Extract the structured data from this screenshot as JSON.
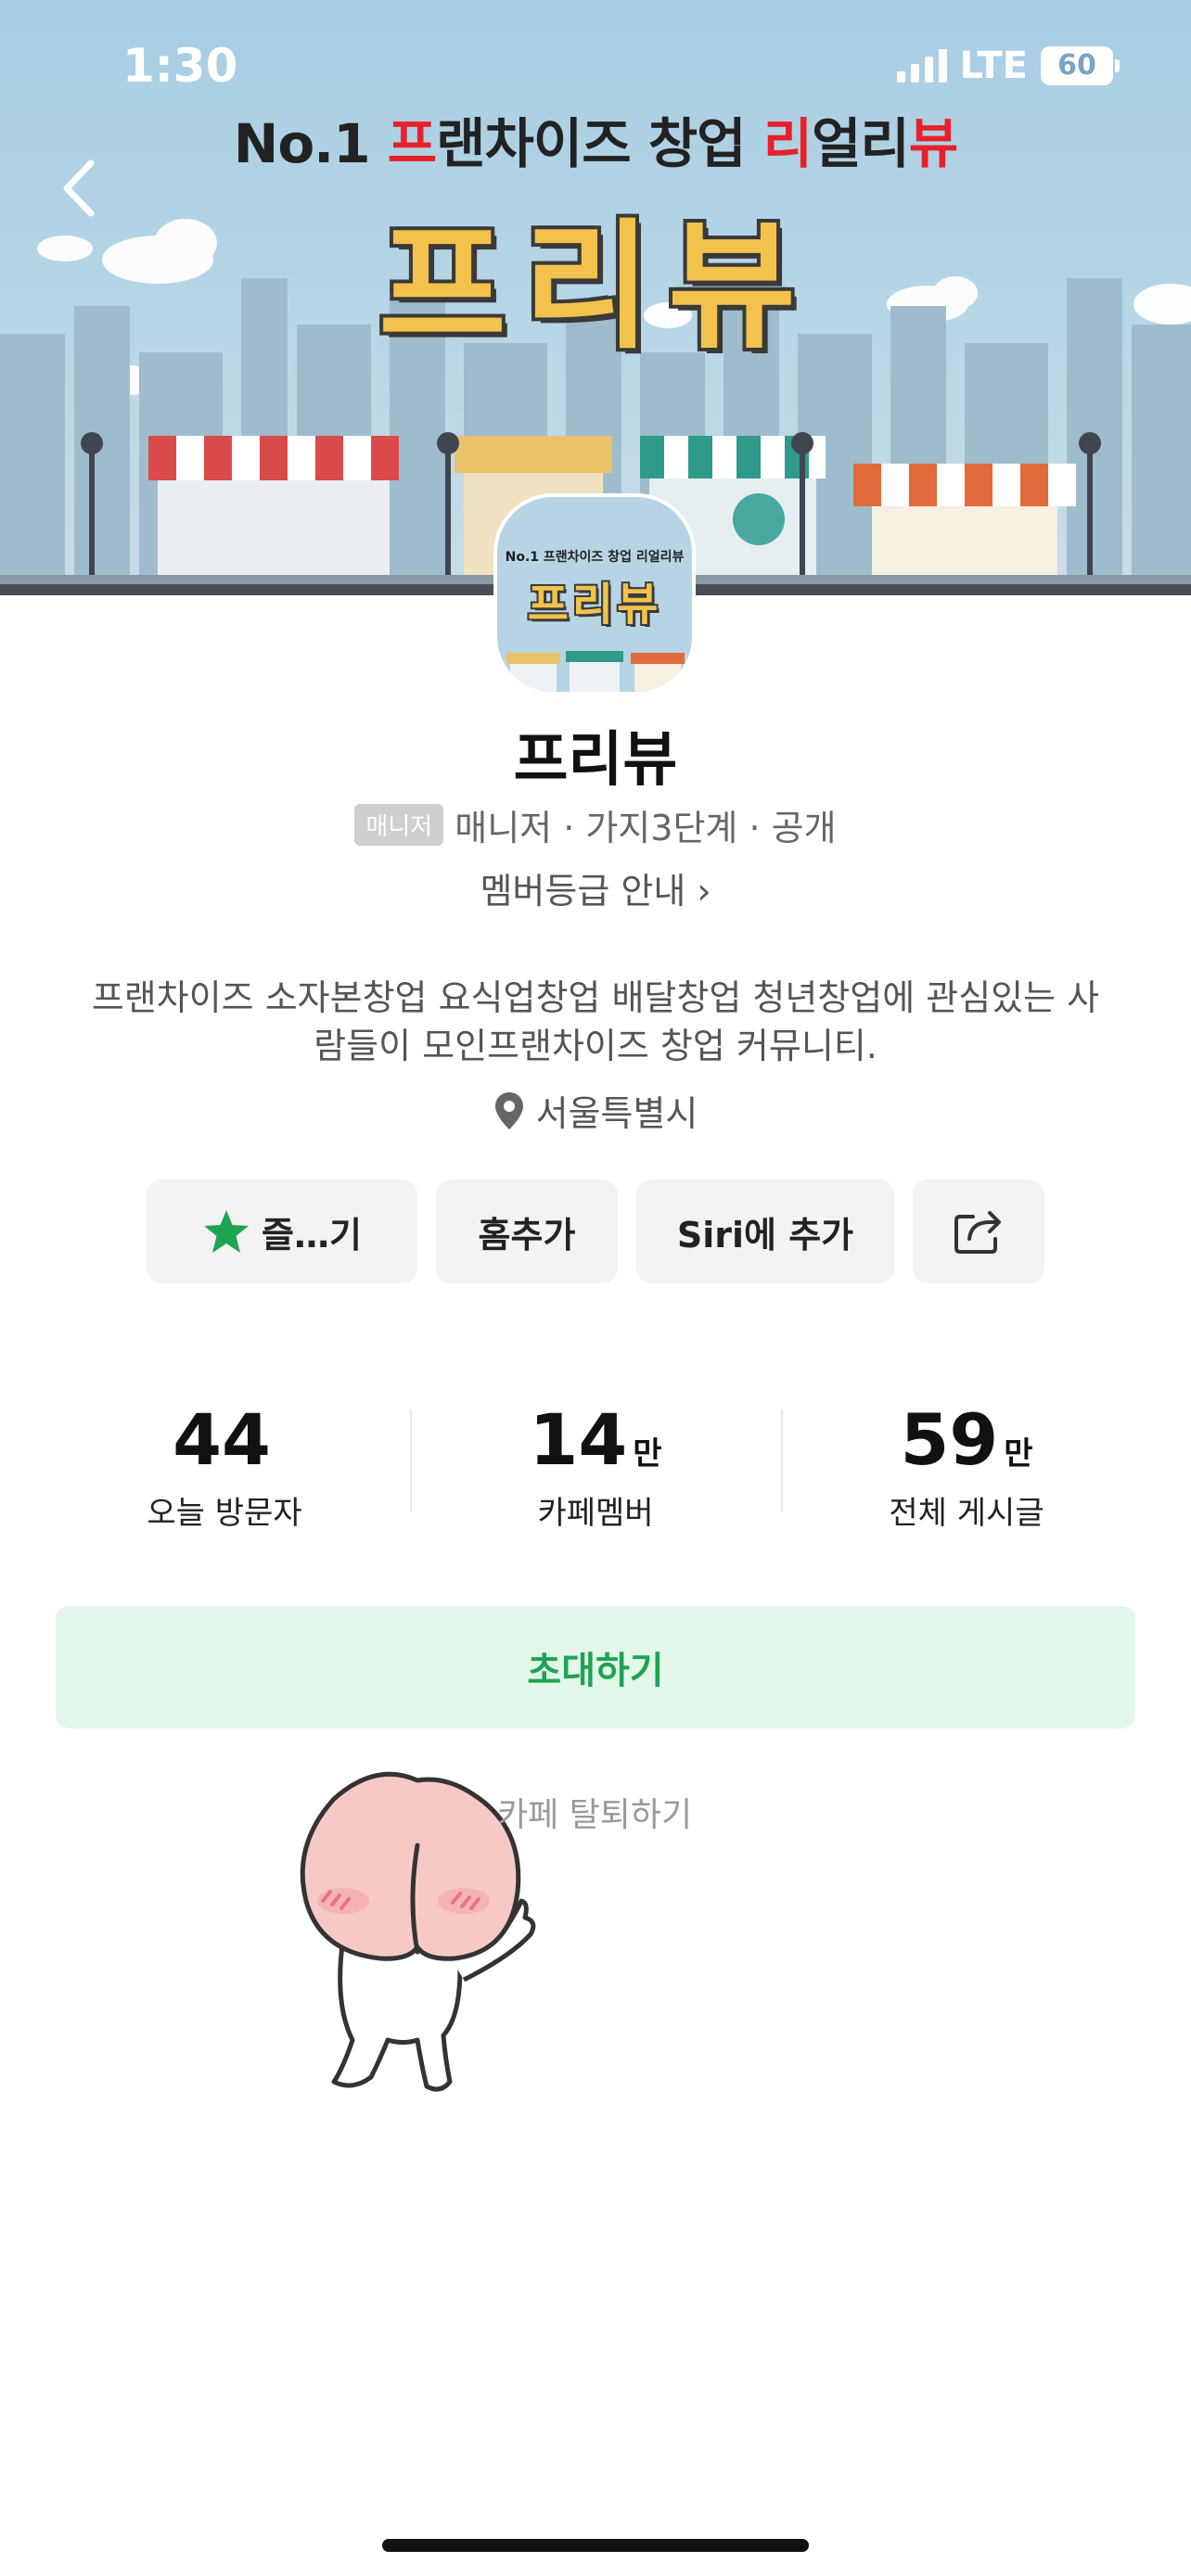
{
  "status_bar": {
    "time": "1:30",
    "network": "LTE",
    "battery": "60"
  },
  "banner": {
    "tagline_parts": [
      "No.1 ",
      "프",
      "랜차이즈 창업 ",
      "리",
      "얼리",
      "뷰"
    ],
    "title": "프리뷰",
    "avatar_tag": "No.1 프랜차이즈 창업 리얼리뷰",
    "avatar_title": "프리뷰"
  },
  "cafe": {
    "name": "프리뷰",
    "manager_badge": "매니저",
    "meta": "매니저 · 가지3단계 · 공개",
    "grade_link": "멤버등급 안내 ›",
    "description": "프랜차이즈 소자본창업 요식업창업 배달창업 청년창업에 관심있는 사람들이 모인프랜차이즈 창업 커뮤니티.",
    "location": "서울특별시"
  },
  "actions": {
    "favorite": "즐…기",
    "home_add": "홈추가",
    "siri_bold": "Siri",
    "siri_rest": "에 추가"
  },
  "stats": [
    {
      "value": "44",
      "unit": "",
      "label": "오늘 방문자"
    },
    {
      "value": "14",
      "unit": "만",
      "label": "카페멤버"
    },
    {
      "value": "59",
      "unit": "만",
      "label": "전체 게시글"
    }
  ],
  "invite_label": "초대하기",
  "leave_label": "카페 탈퇴하기",
  "colors": {
    "accent_green": "#1ea352",
    "invite_bg": "#e2f7e9",
    "title_yellow": "#f2c24c",
    "tagline_red": "#e8202a"
  }
}
